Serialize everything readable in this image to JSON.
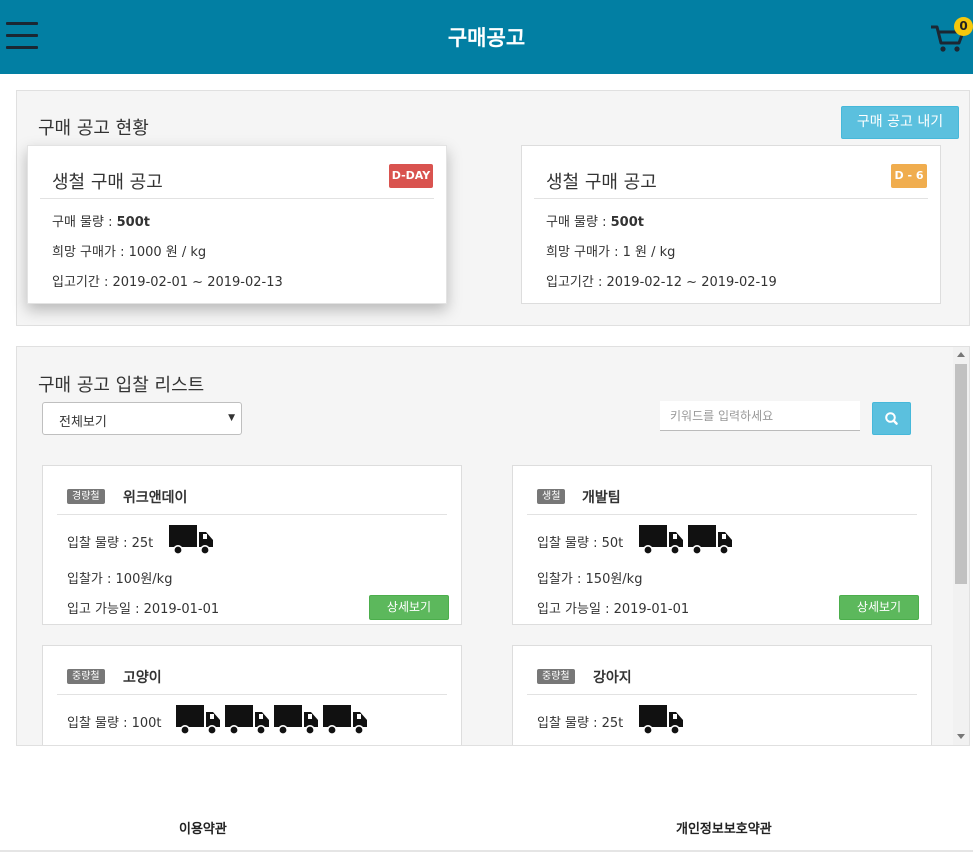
{
  "header": {
    "title": "구매공고",
    "cart_count": "0"
  },
  "status_section": {
    "title": "구매 공고 현황",
    "post_button_label": "구매 공고 내기",
    "notices": [
      {
        "title": "생철 구매 공고",
        "badge": "D-DAY",
        "badge_color": "#d9534f",
        "quantity_label": "구매 물량 : ",
        "quantity": "500t",
        "price": "희망 구매가 : 1000 원 / kg",
        "period": "입고기간 : 2019-02-01 ~ 2019-02-13"
      },
      {
        "title": "생철 구매 공고",
        "badge": "D - 6",
        "badge_color": "#f0ad4e",
        "quantity_label": "구매 물량 : ",
        "quantity": "500t",
        "price": "희망 구매가 : 1 원 / kg",
        "period": "입고기간 : 2019-02-12 ~ 2019-02-19"
      }
    ]
  },
  "bid_section": {
    "title": "구매 공고 입찰 리스트",
    "filter_selected": "전체보기",
    "search_placeholder": "키워드를 입력하세요",
    "detail_label": "상세보기",
    "bids": [
      {
        "tag": "경량철",
        "name": "위크앤데이",
        "amount": "입찰 물량 : 25t",
        "truck_count": 1,
        "price": "입찰가 : 100원/kg",
        "date": "입고 가능일 : 2019-01-01"
      },
      {
        "tag": "생철",
        "name": "개발팀",
        "amount": "입찰 물량 : 50t",
        "truck_count": 2,
        "price": "입찰가 : 150원/kg",
        "date": "입고 가능일 : 2019-01-01"
      },
      {
        "tag": "중량철",
        "name": "고양이",
        "amount": "입찰 물량 : 100t",
        "truck_count": 4,
        "price": "",
        "date": ""
      },
      {
        "tag": "중량철",
        "name": "강아지",
        "amount": "입찰 물량 : 25t",
        "truck_count": 1,
        "price": "",
        "date": ""
      }
    ]
  },
  "footer": {
    "terms": "이용약관",
    "privacy": "개인정보보호약관"
  },
  "colors": {
    "header": "#027fa3",
    "accent": "#5bc0de",
    "success": "#5cb85c",
    "cart_badge": "#f5c80c"
  }
}
